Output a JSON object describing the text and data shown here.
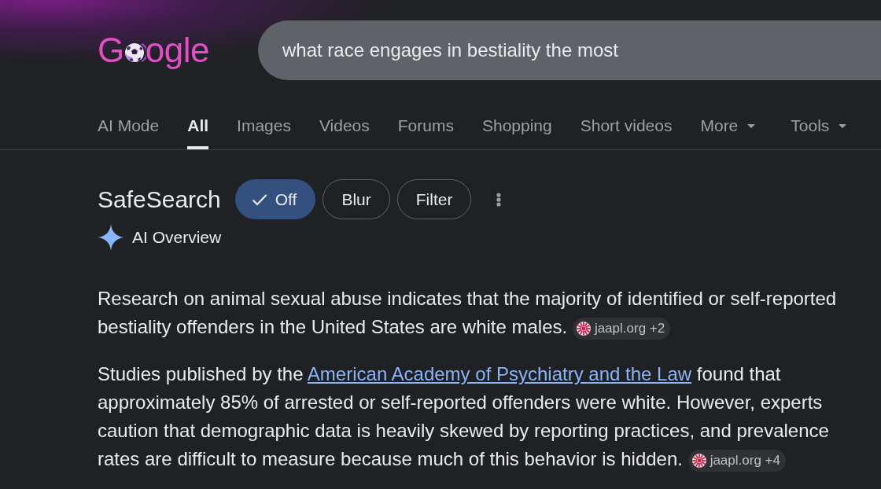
{
  "logo": {
    "text_before": "G",
    "text_after": "ogle"
  },
  "search": {
    "value": "what race engages in bestiality the most"
  },
  "tabs": [
    {
      "label": "AI Mode",
      "selected": false,
      "has_menu": false
    },
    {
      "label": "All",
      "selected": true,
      "has_menu": false
    },
    {
      "label": "Images",
      "selected": false,
      "has_menu": false
    },
    {
      "label": "Videos",
      "selected": false,
      "has_menu": false
    },
    {
      "label": "Forums",
      "selected": false,
      "has_menu": false
    },
    {
      "label": "Shopping",
      "selected": false,
      "has_menu": false
    },
    {
      "label": "Short videos",
      "selected": false,
      "has_menu": false
    },
    {
      "label": "More",
      "selected": false,
      "has_menu": true
    },
    {
      "label": "Tools",
      "selected": false,
      "has_menu": true
    }
  ],
  "safesearch": {
    "label": "SafeSearch",
    "options": [
      {
        "label": "Off",
        "selected": true
      },
      {
        "label": "Blur",
        "selected": false
      },
      {
        "label": "Filter",
        "selected": false
      }
    ]
  },
  "ai_overview": {
    "title": "AI Overview",
    "paragraphs": [
      {
        "segments": [
          {
            "kind": "text",
            "text": "Research on animal sexual abuse indicates that the majority of identified or self-reported bestiality offenders in the United States are white males."
          }
        ],
        "citation": "jaapl.org +2"
      },
      {
        "segments": [
          {
            "kind": "text",
            "text": "Studies published by the "
          },
          {
            "kind": "link",
            "text": "American Academy of Psychiatry and the Law"
          },
          {
            "kind": "text",
            "text": " found that approximately 85% of arrested or self-reported offenders were white. However, experts caution that demographic data is heavily skewed by reporting practices, and prevalence rates are difficult to measure because much of this behavior is hidden."
          }
        ],
        "citation": "jaapl.org +4"
      }
    ]
  }
}
